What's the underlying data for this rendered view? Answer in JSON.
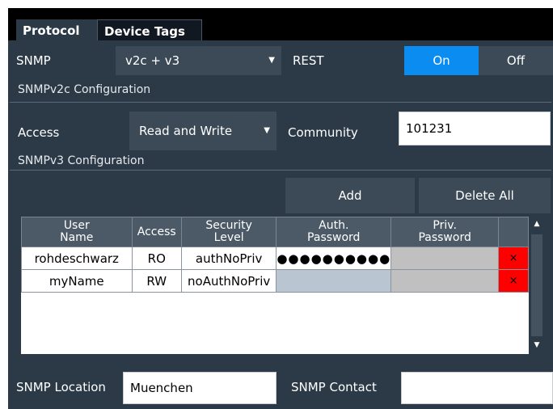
{
  "tabs": [
    {
      "label": "Protocol",
      "active": true
    },
    {
      "label": "Device Tags",
      "active": false
    }
  ],
  "snmp": {
    "label": "SNMP",
    "value": "v2c + v3"
  },
  "rest": {
    "label": "REST",
    "on_label": "On",
    "off_label": "Off",
    "selected": "On"
  },
  "v2c": {
    "section_title": "SNMPv2c Configuration",
    "access_label": "Access",
    "access_value": "Read and Write",
    "community_label": "Community",
    "community_value": "101231"
  },
  "v3": {
    "section_title": "SNMPv3 Configuration",
    "add_label": "Add",
    "delete_all_label": "Delete All",
    "columns": [
      "User Name",
      "Access",
      "Security Level",
      "Auth. Password",
      "Priv. Password"
    ],
    "column_lines": [
      [
        "User",
        "Name"
      ],
      [
        "Access"
      ],
      [
        "Security",
        "Level"
      ],
      [
        "Auth.",
        "Password"
      ],
      [
        "Priv.",
        "Password"
      ]
    ],
    "rows": [
      {
        "user": "rohdeschwarz",
        "access": "RO",
        "security": "authNoPriv",
        "auth_password": "●●●●●●●●●●",
        "priv_password": "",
        "delete": "×"
      },
      {
        "user": "myName",
        "access": "RW",
        "security": "noAuthNoPriv",
        "auth_password": "",
        "priv_password": "",
        "delete": "×"
      }
    ]
  },
  "location": {
    "label": "SNMP Location",
    "value": "Muenchen"
  },
  "contact": {
    "label": "SNMP Contact",
    "value": ""
  },
  "colors": {
    "accent": "#0a8cf0",
    "panel": "#2c3a48",
    "delete": "#ff0000"
  }
}
